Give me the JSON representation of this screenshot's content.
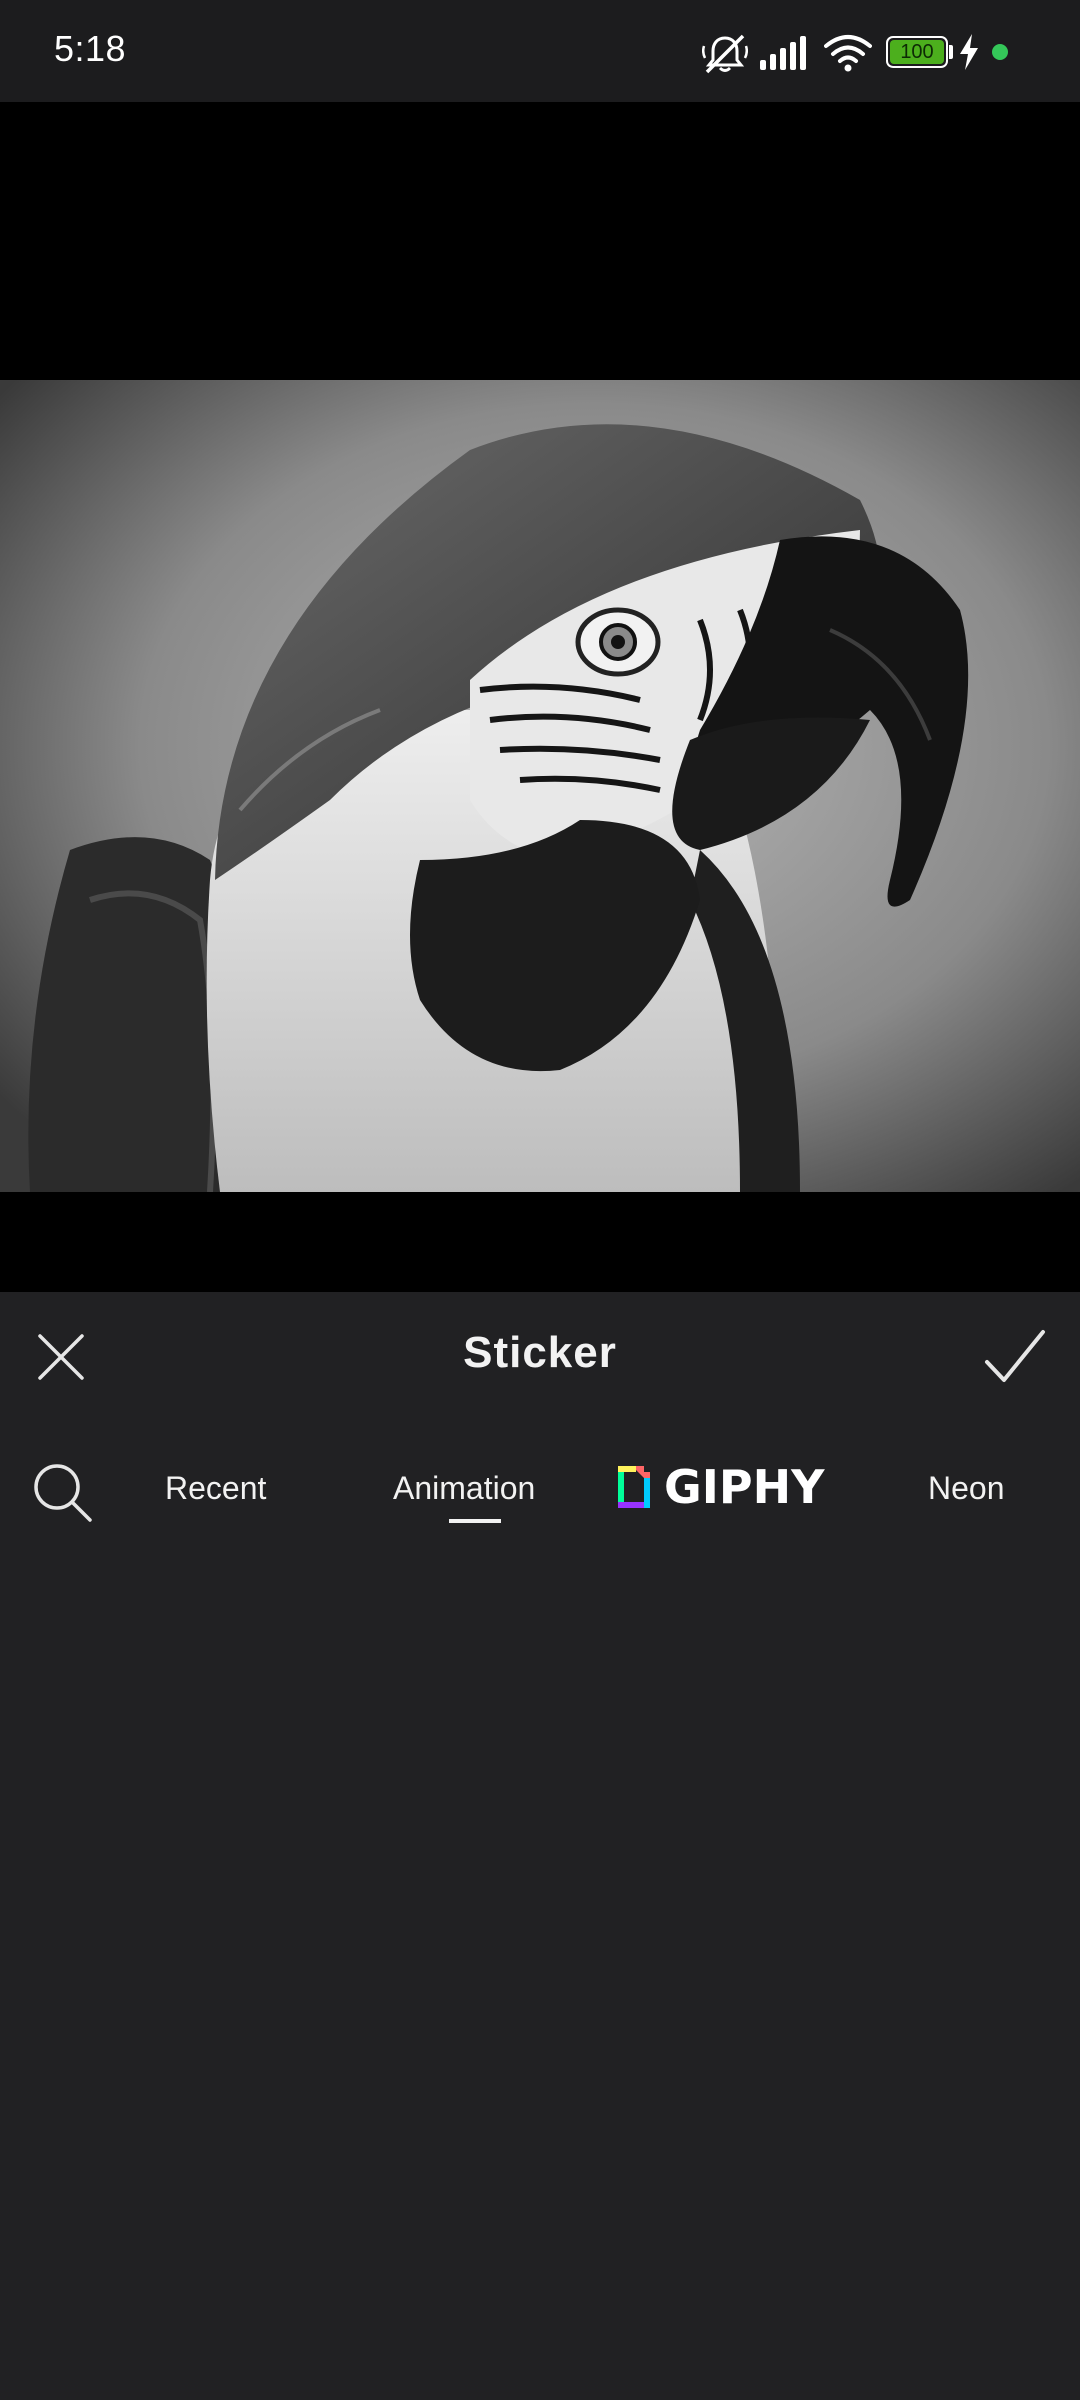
{
  "status_bar": {
    "time": "5:18",
    "battery_level": "100",
    "icons": [
      "mute-icon",
      "signal-icon",
      "wifi-icon",
      "battery-icon",
      "charging-icon",
      "dot-indicator-icon"
    ],
    "indicator_color": "#34c759",
    "battery_color": "#4caf1d"
  },
  "editor": {
    "image_alt": "black and white parrot photo"
  },
  "sticker_panel": {
    "title": "Sticker",
    "close_icon": "close-icon",
    "confirm_icon": "checkmark-icon",
    "search_icon": "search-icon",
    "tabs": [
      {
        "label": "Recent",
        "active": false
      },
      {
        "label": "Animation",
        "active": true
      },
      {
        "label": "GIPHY",
        "active": false,
        "logo": true
      },
      {
        "label": "Neon",
        "active": false
      }
    ]
  }
}
